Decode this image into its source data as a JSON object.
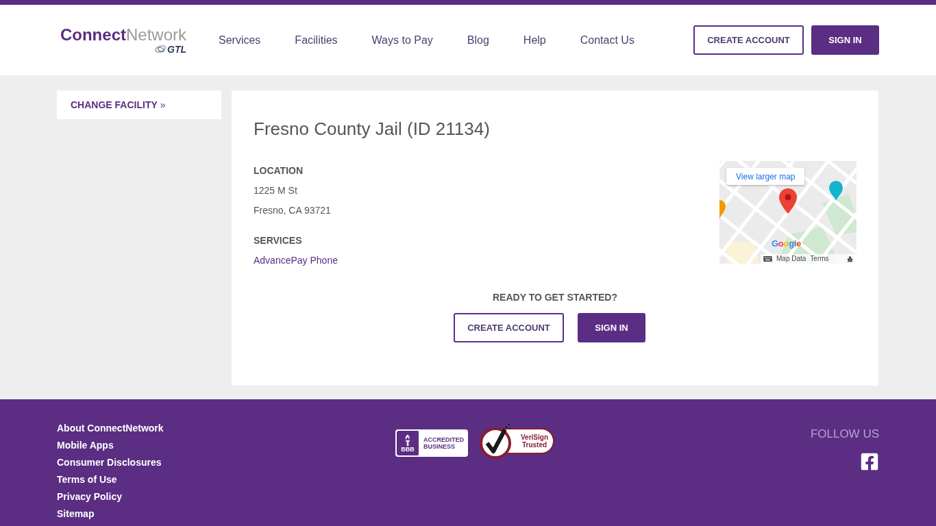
{
  "header": {
    "logo": {
      "primary": "Connect",
      "secondary": "Network",
      "sub": "GTL"
    },
    "nav": [
      "Services",
      "Facilities",
      "Ways to Pay",
      "Blog",
      "Help",
      "Contact Us"
    ],
    "buttons": [
      {
        "label": "CREATE ACCOUNT",
        "kind": "outline"
      },
      {
        "label": "SIGN IN",
        "kind": "filled"
      }
    ]
  },
  "sidebar": {
    "link": "**CHANGE FACILITY** »"
  },
  "facility": {
    "title": "Fresno County Jail (ID 21134)",
    "sections": [
      {
        "heading": "LOCATION",
        "kind": "text",
        "lines": [
          "1225 M St",
          "Fresno, CA 93721"
        ]
      },
      {
        "heading": "SERVICES",
        "kind": "link",
        "lines": [
          "AdvancePay Phone"
        ]
      }
    ],
    "map": {
      "button": "View larger map",
      "logo": "Google",
      "links": [
        "Map Data",
        "Terms"
      ]
    },
    "cta": {
      "heading": "READY TO GET STARTED?",
      "buttons": [
        {
          "label": "CREATE ACCOUNT",
          "kind": "outline"
        },
        {
          "label": "SIGN IN",
          "kind": "filled"
        }
      ]
    }
  },
  "footer": {
    "links": [
      "About ConnectNetwork",
      "Mobile Apps",
      "Consumer Disclosures",
      "Terms of Use",
      "Privacy Policy",
      "Sitemap"
    ],
    "badges": [
      {
        "kind": "bbb",
        "mark": "BBB",
        "text": "ACCREDITED BUSINESS"
      },
      {
        "kind": "verisign",
        "text": "VeriSign Trusted"
      }
    ],
    "follow": "FOLLOW US"
  }
}
